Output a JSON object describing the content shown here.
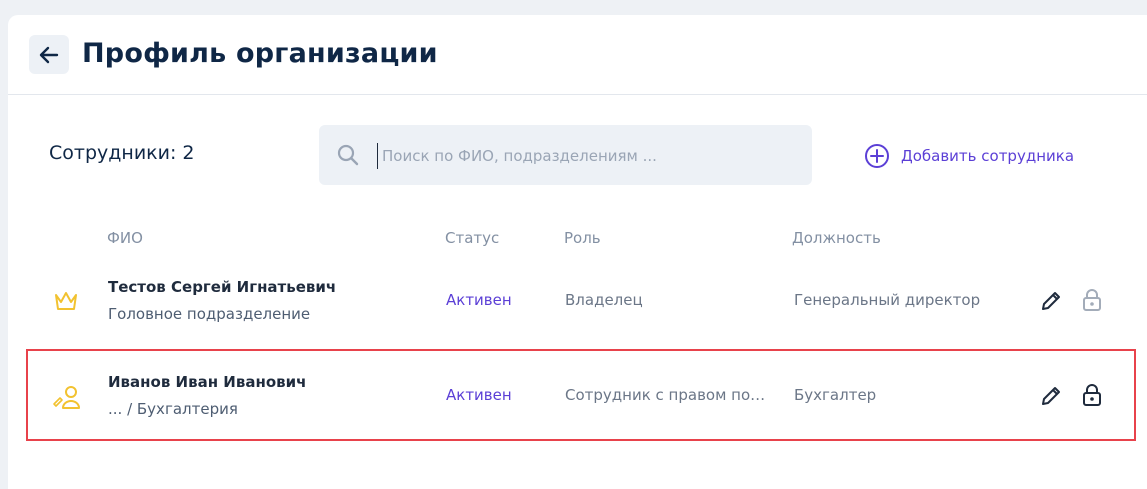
{
  "header": {
    "title": "Профиль организации"
  },
  "employees": {
    "count_label": "Сотрудники: 2"
  },
  "search": {
    "placeholder": "Поиск по ФИО, подразделениям ..."
  },
  "actions": {
    "add_label": "Добавить сотрудника"
  },
  "table": {
    "columns": [
      "ФИО",
      "Статус",
      "Роль",
      "Должность"
    ],
    "rows": [
      {
        "icon": "crown-icon",
        "name": "Тестов Сергей Игнатьевич",
        "department": "Головное подразделение",
        "status": "Активен",
        "role": "Владелец",
        "position": "Генеральный директор",
        "lock": "unlocked-gray"
      },
      {
        "icon": "user-sign-icon",
        "name": "Иванов Иван Иванович",
        "department": "... / Бухгалтерия",
        "status": "Активен",
        "role": "Сотрудник с правом по…",
        "position": "Бухгалтер",
        "lock": "locked-dark",
        "selected": true
      }
    ]
  },
  "colors": {
    "accent": "#5b3fd6",
    "title": "#0f2746",
    "icon_yellow": "#f2c230",
    "selection_border": "#e8424b"
  }
}
